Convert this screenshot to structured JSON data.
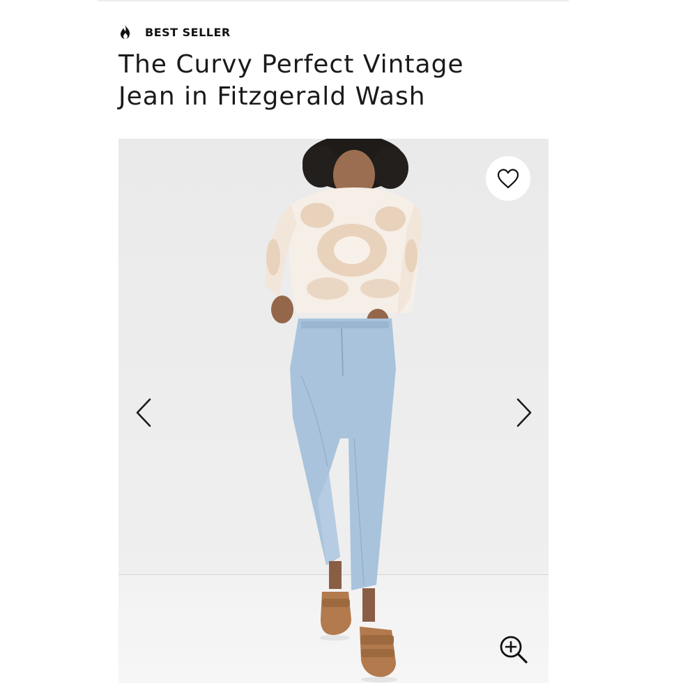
{
  "badge": {
    "label": "BEST SELLER",
    "icon": "flame-icon"
  },
  "product": {
    "title_line1": "The Curvy Perfect Vintage",
    "title_line2": "Jean in Fitzgerald Wash"
  },
  "gallery": {
    "image_alt": "Model wearing tie-dye sweatshirt, light wash jeans and tan sandals",
    "wishlist_icon": "heart-outline-icon",
    "prev_icon": "chevron-left-icon",
    "next_icon": "chevron-right-icon",
    "zoom_icon": "zoom-in-icon"
  },
  "colors": {
    "text": "#111111",
    "background": "#ffffff",
    "photo_wall": "#ebebeb",
    "denim": "#a9c3dc",
    "sandal": "#b27a4d",
    "sweater_tint": "#e3cdb6"
  }
}
